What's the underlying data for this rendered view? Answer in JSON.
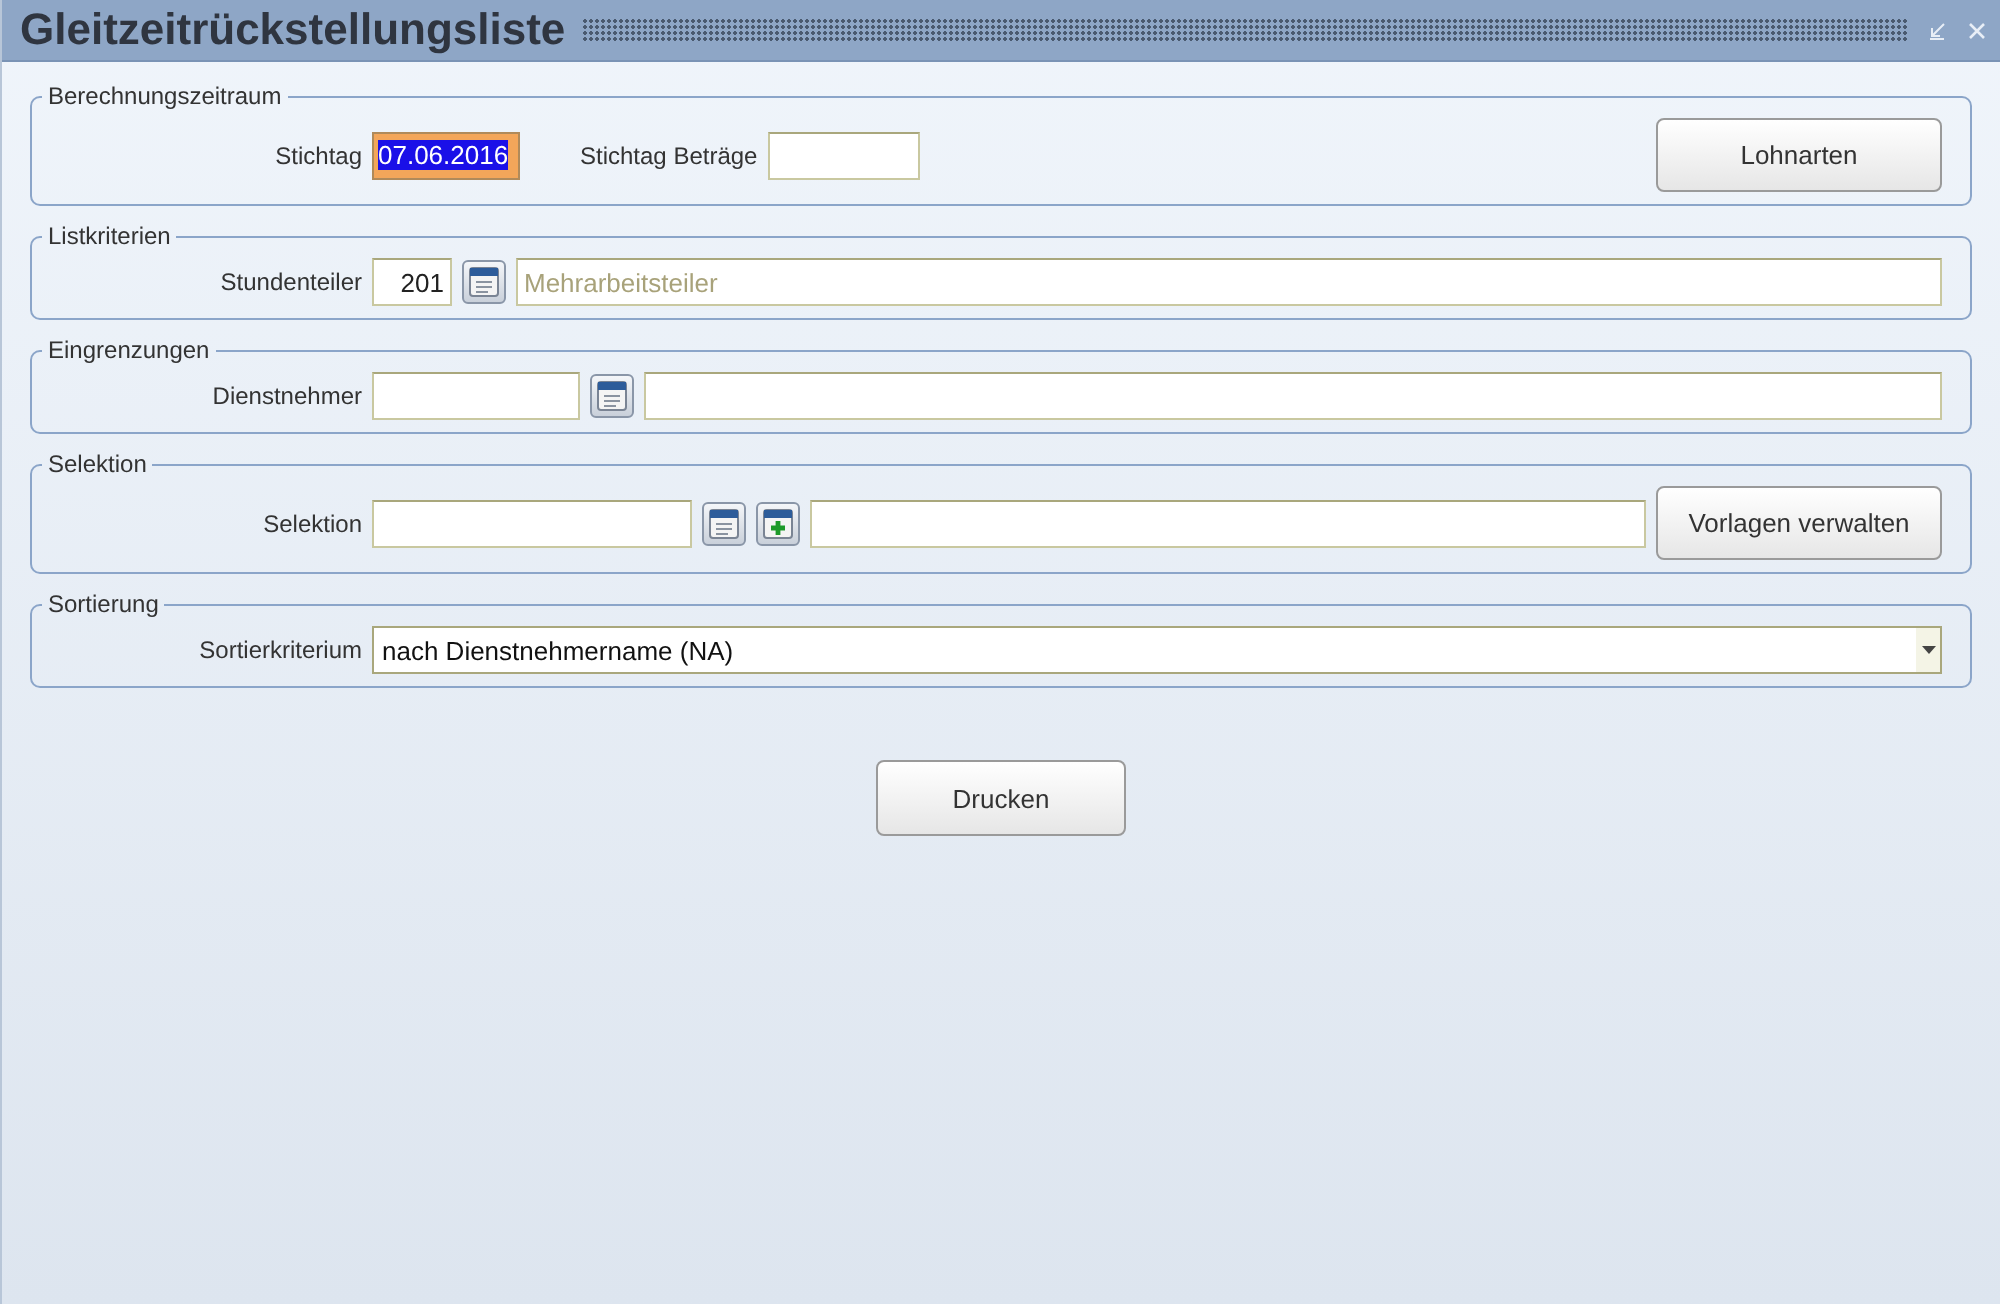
{
  "window": {
    "title": "Gleitzeitrückstellungsliste"
  },
  "sections": [
    {
      "legend": "Berechnungszeitraum",
      "items": [
        {
          "kind": "label",
          "text": "Stichtag"
        },
        {
          "kind": "date",
          "value": "07.06.2016",
          "highlighted": true
        },
        {
          "kind": "label",
          "text": "Stichtag Beträge"
        },
        {
          "kind": "amount",
          "highlighted": false
        },
        {
          "kind": "button",
          "text": "Lohnarten"
        }
      ]
    },
    {
      "legend": "Listkriterien",
      "items": [
        {
          "kind": "label",
          "text": "Stundenteiler"
        },
        {
          "kind": "code",
          "value": "201",
          "highlighted": false
        },
        {
          "kind": "lookup"
        },
        {
          "kind": "text",
          "placeholder": "Mehrarbeitsteiler",
          "highlighted": false
        }
      ]
    },
    {
      "legend": "Eingrenzungen",
      "items": [
        {
          "kind": "label",
          "text": "Dienstnehmer"
        },
        {
          "kind": "personnel",
          "highlighted": false
        },
        {
          "kind": "lookup"
        },
        {
          "kind": "text",
          "highlighted": false
        }
      ]
    },
    {
      "legend": "Selektion",
      "items": [
        {
          "kind": "label",
          "text": "Selektion"
        },
        {
          "kind": "selection",
          "highlighted": false
        },
        {
          "kind": "lookup"
        },
        {
          "kind": "add"
        },
        {
          "kind": "text",
          "highlighted": false
        },
        {
          "kind": "button",
          "text": "Vorlagen verwalten"
        }
      ]
    },
    {
      "legend": "Sortierung",
      "items": [
        {
          "kind": "label",
          "text": "Sortierkriterium"
        },
        {
          "kind": "select",
          "value": "nach Dienstnehmername (NA)"
        }
      ]
    }
  ],
  "actions": [
    "Drucken"
  ]
}
